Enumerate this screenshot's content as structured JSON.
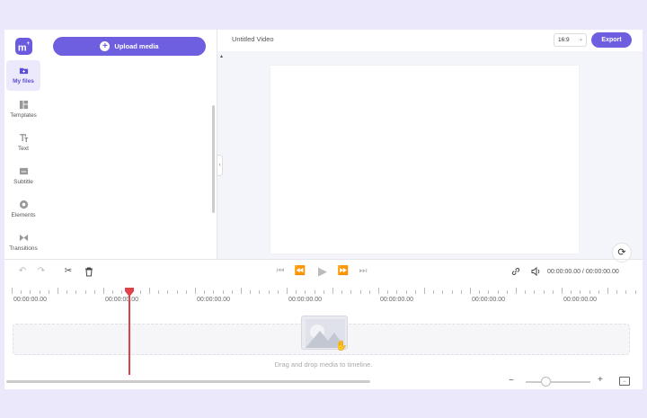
{
  "app": {
    "logo_text": "m",
    "logo_sup": "+",
    "video_title": "Untitled Video",
    "accent_color": "#6d5fe0",
    "playhead_color": "#e0424a"
  },
  "rail": {
    "items": [
      {
        "label": "My files",
        "icon": "folder-plus-icon"
      },
      {
        "label": "Templates",
        "icon": "templates-icon"
      },
      {
        "label": "Text",
        "icon": "text-icon"
      },
      {
        "label": "Subtitle",
        "icon": "subtitle-icon"
      },
      {
        "label": "Elements",
        "icon": "elements-icon"
      },
      {
        "label": "Transitions",
        "icon": "transitions-icon"
      }
    ],
    "active_index": 0
  },
  "media_panel": {
    "upload_label": "Upload media"
  },
  "topbar": {
    "ratio": "16:9",
    "export_label": "Export"
  },
  "controls": {
    "time_readout": "00:00:00.00 / 00:00:00.00"
  },
  "timeline": {
    "labels": [
      "00:00:00.00",
      "00:00:00.00",
      "00:00:00.00",
      "00:00:00.00",
      "00:00:00.00",
      "00:00:00.00",
      "00:00:00.00"
    ],
    "drop_hint": "Drag and drop media to timeline."
  },
  "zoom": {
    "minus": "−",
    "plus": "+",
    "level": 0.3
  }
}
